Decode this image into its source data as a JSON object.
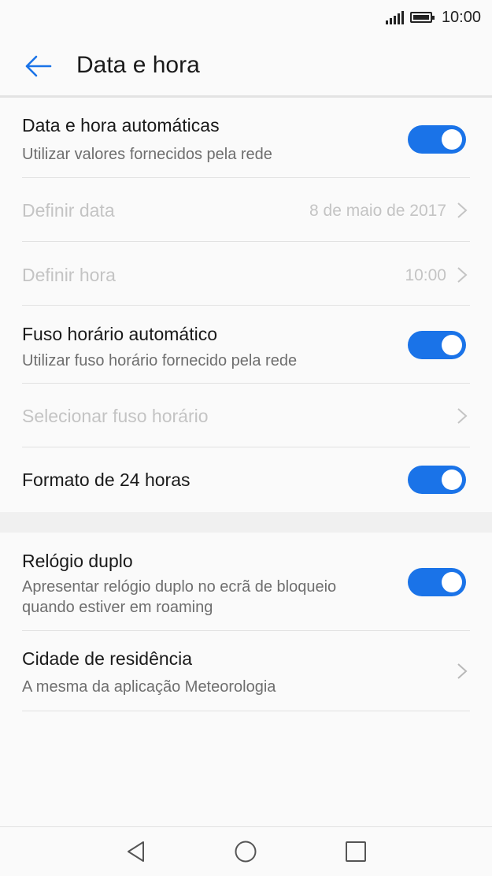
{
  "status_bar": {
    "time": "10:00"
  },
  "app_bar": {
    "title": "Data e hora"
  },
  "settings": {
    "auto_datetime": {
      "label": "Data e hora automáticas",
      "summary": "Utilizar valores fornecidos pela rede",
      "enabled": true
    },
    "set_date": {
      "label": "Definir data",
      "value": "8 de maio de 2017"
    },
    "set_time": {
      "label": "Definir hora",
      "value": "10:00"
    },
    "auto_timezone": {
      "label": "Fuso horário automático",
      "summary": "Utilizar fuso horário fornecido pela rede",
      "enabled": true
    },
    "select_timezone": {
      "label": "Selecionar fuso horário"
    },
    "format_24h": {
      "label": "Formato de 24 horas",
      "enabled": true
    },
    "dual_clock": {
      "label": "Relógio duplo",
      "summary_line1": "Apresentar relógio duplo no ecrã de bloqueio",
      "summary_line2": "quando estiver em roaming",
      "enabled": true
    },
    "home_city": {
      "label": "Cidade de residência",
      "summary": "A mesma da aplicação Meteorologia"
    }
  },
  "colors": {
    "accent": "#1a73e8",
    "disabled_text": "#c4c4c4"
  }
}
